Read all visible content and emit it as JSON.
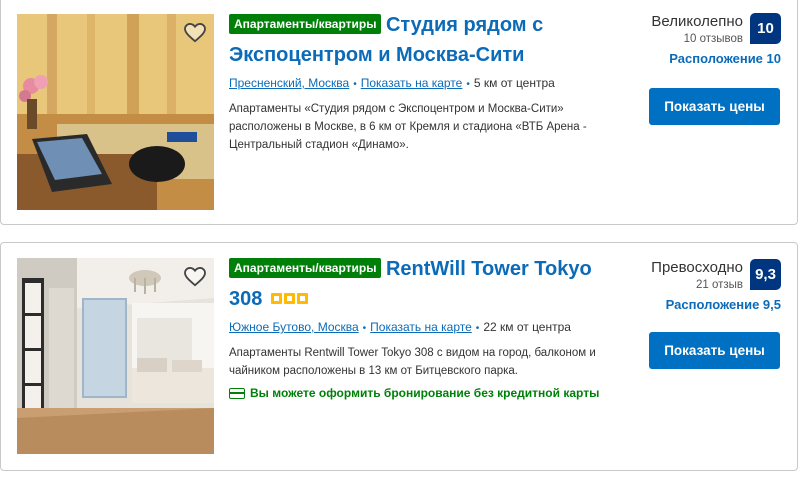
{
  "listings": [
    {
      "type_badge": "Апартаменты/квартиры",
      "title": "Студия рядом с Экспоцентром и Москва-Сити",
      "district": "Пресненский, Москва",
      "show_map": "Показать на карте",
      "distance": "5 км от центра",
      "description": "Апартаменты «Студия рядом с Экспоцентром и Москва-Сити» расположены в Москве, в 6 км от Кремля и стадиона «ВТБ Арена - Центральный стадион «Динамо».",
      "rating_word": "Великолепно",
      "reviews": "10 отзывов",
      "score": "10",
      "location_score": "Расположение 10",
      "button": "Показать цены",
      "stars": 0
    },
    {
      "type_badge": "Апартаменты/квартиры",
      "title": "RentWill Tower Tokyo 308",
      "district": "Южное Бутово, Москва",
      "show_map": "Показать на карте",
      "distance": "22 км от центра",
      "description": "Апартаменты Rentwill Tower Tokyo 308 с видом на город, балконом и чайником расположены в 13 км от Битцевского парка.",
      "no_card": "Вы можете оформить бронирование без кредитной карты",
      "rating_word": "Превосходно",
      "reviews": "21 отзыв",
      "score": "9,3",
      "location_score": "Расположение 9,5",
      "button": "Показать цены",
      "stars": 3
    }
  ],
  "colors": {
    "link": "#0b6bb8",
    "badge_green": "#008009",
    "score_bg": "#003580",
    "button_bg": "#0071c2",
    "star": "#febb02"
  },
  "icons": [
    "heart-icon",
    "star-icon",
    "credit-card-icon"
  ]
}
